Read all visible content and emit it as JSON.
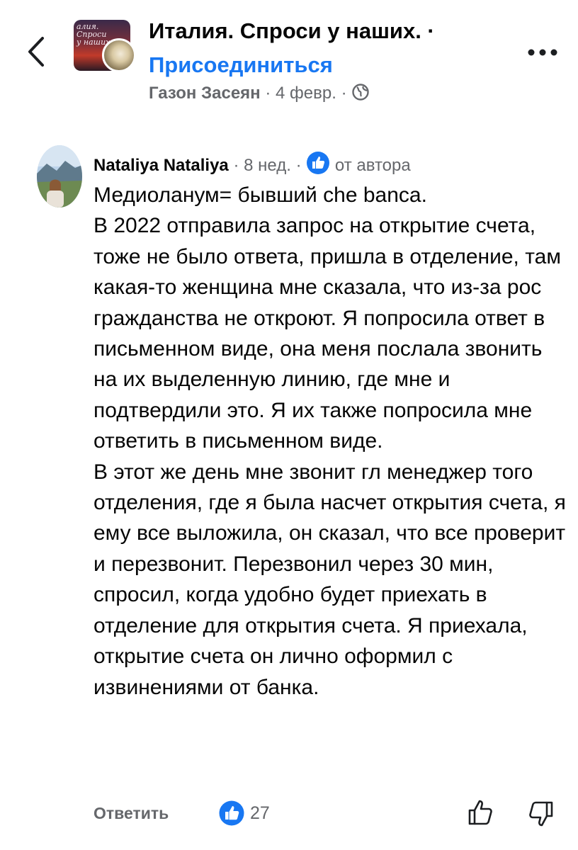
{
  "header": {
    "group_title": "Италия. Спроси у наших. ·",
    "group_image_text": [
      "алия. Спроси",
      "у наших"
    ],
    "join_label": "Присоединиться",
    "author": "Газон Засеян",
    "dot1": "·",
    "date": "4 февр.",
    "dot2": "·",
    "privacy_icon": "globe-icon",
    "more_icon": "more-dots-icon",
    "back_icon": "chevron-left-icon"
  },
  "comment": {
    "name": "Nataliya Nataliya",
    "dot1": "·",
    "time": "8 нед.",
    "dot2": "·",
    "badge_icon": "like-badge-icon",
    "badge_label": "от автора",
    "paragraphs": [
      "Медиоланум= бывший che banca.",
      "В 2022 отправила запрос на открытие счета, тоже не было ответа, пришла в отделение, там какая-то женщина мне сказала, что из-за рос гражданства не откроют. Я попросила ответ в письменном виде, она меня послала звонить на их выделенную линию, где мне и подтвердили это. Я их также попросила мне ответить в письменном виде.",
      "В этот же день мне звонит гл менеджер того отделения, где я была насчет открытия счета, я ему все выложила, он сказал, что все проверит и перезвонит. Перезвонил через 30 мин, спросил, когда удобно будет приехать в отделение для открытия счета. Я приехала, открытие счета он лично оформил с извинениями от банка."
    ]
  },
  "footer": {
    "reply_label": "Ответить",
    "reaction_icon": "like-reaction-icon",
    "reaction_count": "27",
    "upvote_icon": "thumbs-up-outline-icon",
    "downvote_icon": "thumbs-down-outline-icon"
  },
  "colors": {
    "accent": "#1877f2",
    "secondary_text": "#65676b",
    "primary_text": "#050505"
  }
}
